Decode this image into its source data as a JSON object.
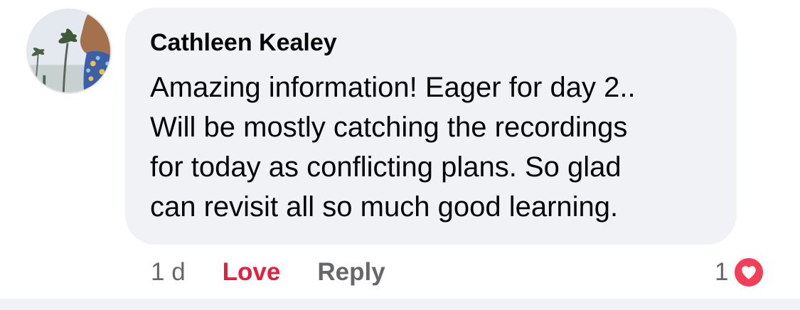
{
  "comment": {
    "author": "Cathleen Kealey",
    "text_lines": [
      "Amazing information! Eager for day 2..",
      "Will be mostly catching the recordings",
      "for today as conflicting plans. So glad",
      "can revisit all so much good learning."
    ],
    "timestamp": "1 d",
    "actions": {
      "love_label": "Love",
      "reply_label": "Reply"
    },
    "reactions": {
      "count": "1",
      "icon": "love-reaction-icon"
    }
  },
  "colors": {
    "bubble_background": "#f0f2f5",
    "love_active": "#e41e3f",
    "secondary_text": "#65676b",
    "love_reaction": "#f33e58"
  }
}
